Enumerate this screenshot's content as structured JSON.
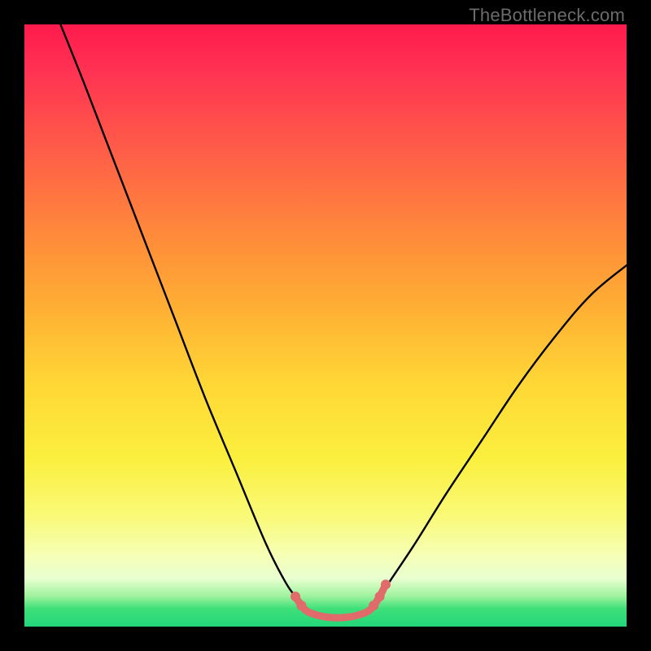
{
  "watermark": "TheBottleneck.com",
  "chart_data": {
    "type": "line",
    "title": "",
    "xlabel": "",
    "ylabel": "",
    "xlim": [
      0,
      100
    ],
    "ylim": [
      0,
      100
    ],
    "grid": false,
    "legend": false,
    "series": [
      {
        "name": "left-curve",
        "x": [
          6,
          10,
          15,
          20,
          25,
          30,
          35,
          40,
          43,
          45,
          47
        ],
        "y": [
          100,
          90,
          77,
          64,
          51,
          38,
          26,
          14,
          8,
          5,
          3
        ]
      },
      {
        "name": "right-curve",
        "x": [
          57,
          59,
          61,
          65,
          70,
          76,
          82,
          88,
          94,
          100
        ],
        "y": [
          3,
          5,
          8,
          14,
          22,
          31,
          40,
          48,
          55,
          60
        ]
      }
    ],
    "highlight": {
      "name": "bottleneck-range",
      "x": [
        45,
        46,
        47,
        49,
        51,
        53,
        55,
        57,
        58,
        59,
        60
      ],
      "y": [
        5,
        3.5,
        2.5,
        1.8,
        1.5,
        1.5,
        1.8,
        2.5,
        3.5,
        5,
        7
      ],
      "style": "marker"
    }
  }
}
